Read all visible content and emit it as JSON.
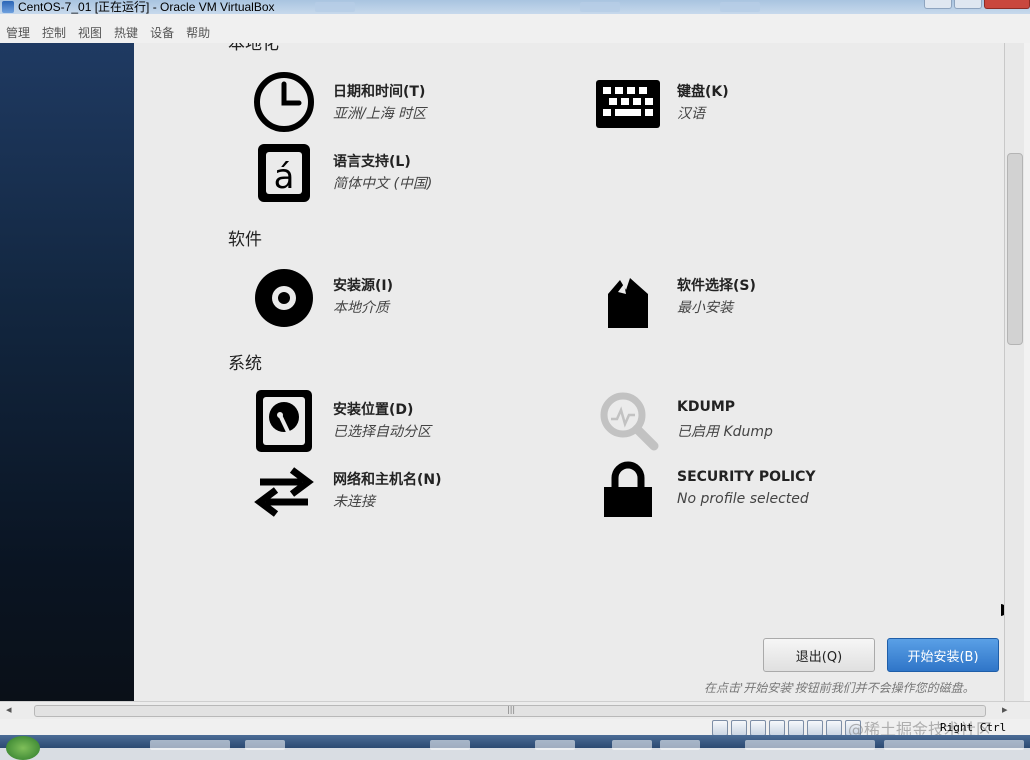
{
  "window": {
    "title": "CentOS-7_01 [正在运行] - Oracle VM VirtualBox"
  },
  "menu": [
    "管理",
    "控制",
    "视图",
    "热键",
    "设备",
    "帮助"
  ],
  "sections": {
    "localization": "本地化",
    "software": "软件",
    "system": "系统"
  },
  "spokes": {
    "datetime": {
      "title": "日期和时间(T)",
      "status": "亚洲/上海 时区",
      "icon": "clock-icon"
    },
    "keyboard": {
      "title": "键盘(K)",
      "status": "汉语",
      "icon": "keyboard-icon"
    },
    "language": {
      "title": "语言支持(L)",
      "status": "简体中文 (中国)",
      "icon": "language-icon"
    },
    "source": {
      "title": "安装源(I)",
      "status": "本地介质",
      "icon": "disc-icon"
    },
    "software": {
      "title": "软件选择(S)",
      "status": "最小安装",
      "icon": "package-icon"
    },
    "destination": {
      "title": "安装位置(D)",
      "status": "已选择自动分区",
      "icon": "harddisk-icon"
    },
    "kdump": {
      "title": "KDUMP",
      "status": "已启用 Kdump",
      "icon": "search-icon"
    },
    "network": {
      "title": "网络和主机名(N)",
      "status": "未连接",
      "icon": "network-arrows-icon"
    },
    "security": {
      "title": "SECURITY POLICY",
      "status": "No profile selected",
      "icon": "lock-icon"
    }
  },
  "buttons": {
    "quit": "退出(Q)",
    "begin": "开始安装(B)"
  },
  "note": "在点击'开始安装'按钮前我们并不会操作您的磁盘。",
  "statusbar": {
    "watermark": "@稀土掘金技术社区",
    "host_key": "Right Ctrl"
  },
  "colors": {
    "accent": "#3a7fd0",
    "sidebar": "#12263f",
    "content_bg": "#ebebeb"
  }
}
